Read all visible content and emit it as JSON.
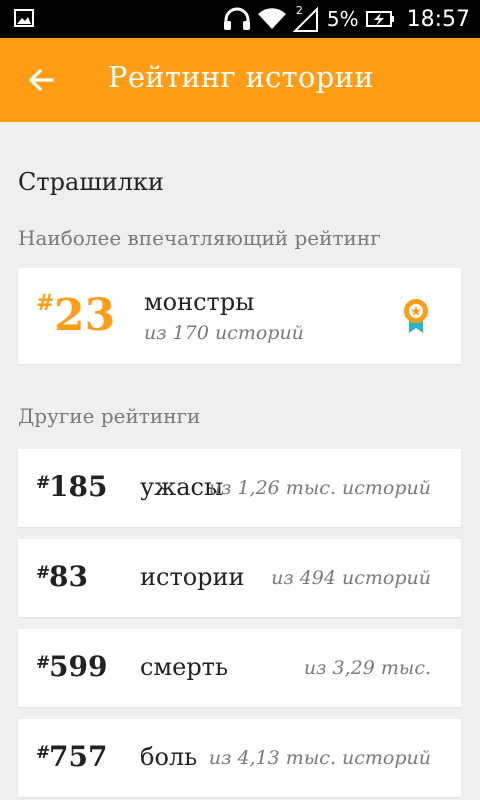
{
  "status_bar": {
    "battery_percent": "5%",
    "time": "18:57",
    "signal_sim_label": "2"
  },
  "toolbar": {
    "title": "Рейтинг истории"
  },
  "category": "Страшилки",
  "featured_section": {
    "heading": "Наиболее впечатляющий рейтинг",
    "hash": "#",
    "rank": "23",
    "tag": "монстры",
    "count": "из 170 историй"
  },
  "other_section": {
    "heading": "Другие рейтинги",
    "items": [
      {
        "hash": "#",
        "rank": "185",
        "tag": "ужасы",
        "count": "из 1,26 тыс. историй"
      },
      {
        "hash": "#",
        "rank": "83",
        "tag": "истории",
        "count": "из 494 историй"
      },
      {
        "hash": "#",
        "rank": "599",
        "tag": "смерть",
        "count": "из 3,29 тыс."
      },
      {
        "hash": "#",
        "rank": "757",
        "tag": "боль",
        "count": "из 4,13 тыс. историй"
      }
    ]
  },
  "colors": {
    "accent": "#ff9e16",
    "background": "#efeef0",
    "medal_ribbon": "#2bb5c8"
  }
}
